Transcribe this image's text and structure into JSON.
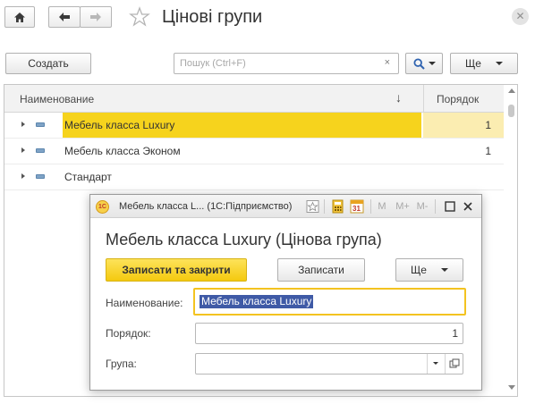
{
  "window": {
    "title": "Цінові групи"
  },
  "nav": {
    "home_icon": "home-icon",
    "back_icon": "arrow-left-icon",
    "forward_icon": "arrow-right-icon",
    "favorite_icon": "star-icon"
  },
  "toolbar": {
    "create_label": "Создать",
    "search": {
      "placeholder": "Пошук (Ctrl+F)",
      "clear": "×"
    },
    "more_label": "Ще"
  },
  "table": {
    "columns": [
      {
        "label": "Наименование",
        "sort": "↓"
      },
      {
        "label": "Порядок"
      }
    ],
    "rows": [
      {
        "name": "Мебель класса Luxury",
        "order": "1",
        "selected": true
      },
      {
        "name": "Мебель класса Эконом",
        "order": "1"
      },
      {
        "name": "Стандарт",
        "order": ""
      }
    ]
  },
  "dialog": {
    "window_title": "Мебель класса L...  (1С:Підприємство)",
    "app_icon": "1С",
    "toolbar_icons": [
      "star-icon",
      "calculator-icon",
      "calendar-icon",
      "M",
      "M+",
      "M-"
    ],
    "calendar_day": "31",
    "heading": "Мебель класса Luxury (Цінова група)",
    "buttons": {
      "save_close": "Записати та закрити",
      "save": "Записати",
      "more": "Ще"
    },
    "fields": {
      "name": {
        "label": "Наименование:",
        "value": "Мебель класса Luxury"
      },
      "order": {
        "label": "Порядок:",
        "value": "1"
      },
      "group": {
        "label": "Група:",
        "value": ""
      }
    }
  },
  "colors": {
    "selection": "#f6d31d",
    "selection_light": "#fbedb1",
    "text_selection": "#3f5aa6",
    "primary_button": "#f4c90f"
  }
}
